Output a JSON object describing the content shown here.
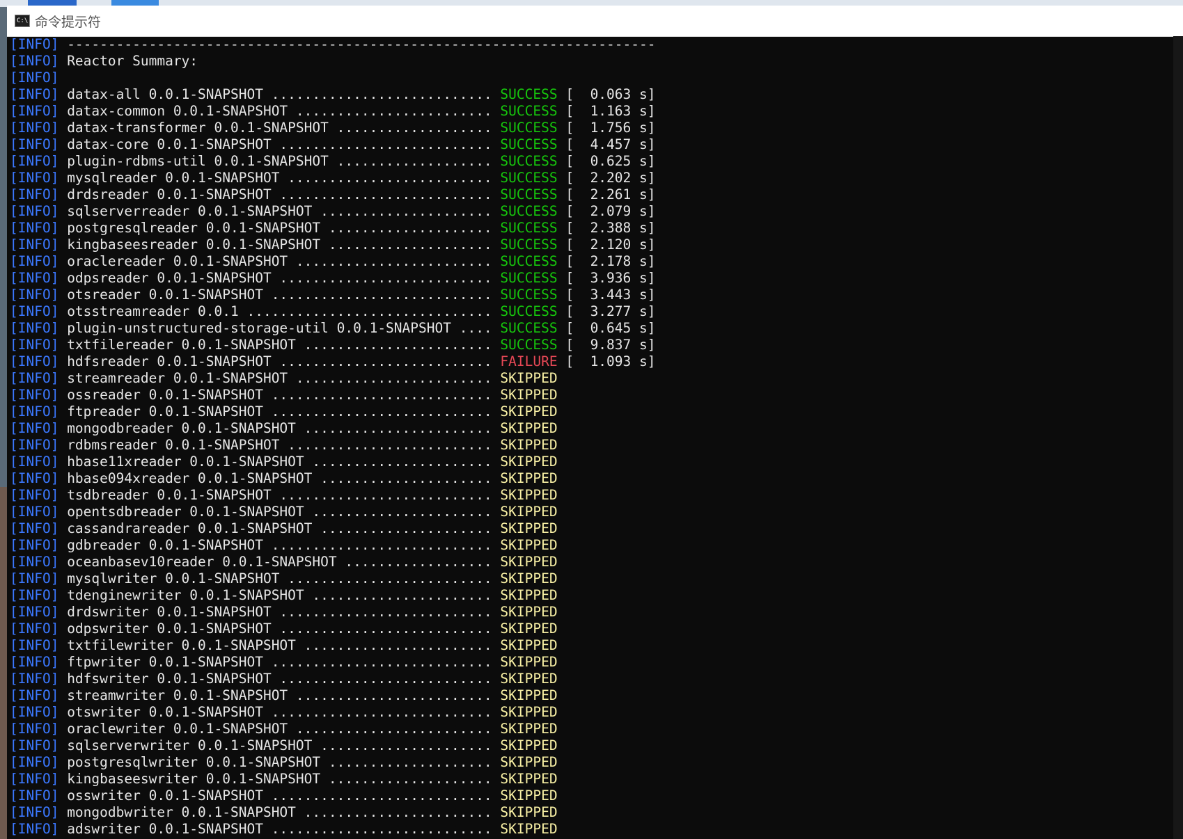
{
  "window": {
    "title": "命令提示符",
    "icon": "cmd-console-icon"
  },
  "console": {
    "colors": {
      "info_tag": "#3b78ff",
      "text": "#e6e6e6",
      "SUCCESS": "#16c60c",
      "FAILURE": "#e74856",
      "SKIPPED": "#f9f1a5",
      "background": "#0c0c0c"
    },
    "lines": [
      {
        "tag": "[INFO]",
        "text": " ------------------------------------------------------------------------"
      },
      {
        "tag": "[INFO]",
        "text": " Reactor Summary:"
      },
      {
        "tag": "[INFO]",
        "text": ""
      },
      {
        "tag": "[INFO]",
        "text": " datax-all 0.0.1-SNAPSHOT ........................... ",
        "status": "SUCCESS",
        "time": " [  0.063 s]"
      },
      {
        "tag": "[INFO]",
        "text": " datax-common 0.0.1-SNAPSHOT ........................ ",
        "status": "SUCCESS",
        "time": " [  1.163 s]"
      },
      {
        "tag": "[INFO]",
        "text": " datax-transformer 0.0.1-SNAPSHOT ................... ",
        "status": "SUCCESS",
        "time": " [  1.756 s]"
      },
      {
        "tag": "[INFO]",
        "text": " datax-core 0.0.1-SNAPSHOT .......................... ",
        "status": "SUCCESS",
        "time": " [  4.457 s]"
      },
      {
        "tag": "[INFO]",
        "text": " plugin-rdbms-util 0.0.1-SNAPSHOT ................... ",
        "status": "SUCCESS",
        "time": " [  0.625 s]"
      },
      {
        "tag": "[INFO]",
        "text": " mysqlreader 0.0.1-SNAPSHOT ......................... ",
        "status": "SUCCESS",
        "time": " [  2.202 s]"
      },
      {
        "tag": "[INFO]",
        "text": " drdsreader 0.0.1-SNAPSHOT .......................... ",
        "status": "SUCCESS",
        "time": " [  2.261 s]"
      },
      {
        "tag": "[INFO]",
        "text": " sqlserverreader 0.0.1-SNAPSHOT ..................... ",
        "status": "SUCCESS",
        "time": " [  2.079 s]"
      },
      {
        "tag": "[INFO]",
        "text": " postgresqlreader 0.0.1-SNAPSHOT .................... ",
        "status": "SUCCESS",
        "time": " [  2.388 s]"
      },
      {
        "tag": "[INFO]",
        "text": " kingbaseesreader 0.0.1-SNAPSHOT .................... ",
        "status": "SUCCESS",
        "time": " [  2.120 s]"
      },
      {
        "tag": "[INFO]",
        "text": " oraclereader 0.0.1-SNAPSHOT ........................ ",
        "status": "SUCCESS",
        "time": " [  2.178 s]"
      },
      {
        "tag": "[INFO]",
        "text": " odpsreader 0.0.1-SNAPSHOT .......................... ",
        "status": "SUCCESS",
        "time": " [  3.936 s]"
      },
      {
        "tag": "[INFO]",
        "text": " otsreader 0.0.1-SNAPSHOT ........................... ",
        "status": "SUCCESS",
        "time": " [  3.443 s]"
      },
      {
        "tag": "[INFO]",
        "text": " otsstreamreader 0.0.1 .............................. ",
        "status": "SUCCESS",
        "time": " [  3.277 s]"
      },
      {
        "tag": "[INFO]",
        "text": " plugin-unstructured-storage-util 0.0.1-SNAPSHOT .... ",
        "status": "SUCCESS",
        "time": " [  0.645 s]"
      },
      {
        "tag": "[INFO]",
        "text": " txtfilereader 0.0.1-SNAPSHOT ....................... ",
        "status": "SUCCESS",
        "time": " [  9.837 s]"
      },
      {
        "tag": "[INFO]",
        "text": " hdfsreader 0.0.1-SNAPSHOT .......................... ",
        "status": "FAILURE",
        "time": " [  1.093 s]"
      },
      {
        "tag": "[INFO]",
        "text": " streamreader 0.0.1-SNAPSHOT ........................ ",
        "status": "SKIPPED"
      },
      {
        "tag": "[INFO]",
        "text": " ossreader 0.0.1-SNAPSHOT ........................... ",
        "status": "SKIPPED"
      },
      {
        "tag": "[INFO]",
        "text": " ftpreader 0.0.1-SNAPSHOT ........................... ",
        "status": "SKIPPED"
      },
      {
        "tag": "[INFO]",
        "text": " mongodbreader 0.0.1-SNAPSHOT ....................... ",
        "status": "SKIPPED"
      },
      {
        "tag": "[INFO]",
        "text": " rdbmsreader 0.0.1-SNAPSHOT ......................... ",
        "status": "SKIPPED"
      },
      {
        "tag": "[INFO]",
        "text": " hbase11xreader 0.0.1-SNAPSHOT ...................... ",
        "status": "SKIPPED"
      },
      {
        "tag": "[INFO]",
        "text": " hbase094xreader 0.0.1-SNAPSHOT ..................... ",
        "status": "SKIPPED"
      },
      {
        "tag": "[INFO]",
        "text": " tsdbreader 0.0.1-SNAPSHOT .......................... ",
        "status": "SKIPPED"
      },
      {
        "tag": "[INFO]",
        "text": " opentsdbreader 0.0.1-SNAPSHOT ...................... ",
        "status": "SKIPPED"
      },
      {
        "tag": "[INFO]",
        "text": " cassandrareader 0.0.1-SNAPSHOT ..................... ",
        "status": "SKIPPED"
      },
      {
        "tag": "[INFO]",
        "text": " gdbreader 0.0.1-SNAPSHOT ........................... ",
        "status": "SKIPPED"
      },
      {
        "tag": "[INFO]",
        "text": " oceanbasev10reader 0.0.1-SNAPSHOT .................. ",
        "status": "SKIPPED"
      },
      {
        "tag": "[INFO]",
        "text": " mysqlwriter 0.0.1-SNAPSHOT ......................... ",
        "status": "SKIPPED"
      },
      {
        "tag": "[INFO]",
        "text": " tdenginewriter 0.0.1-SNAPSHOT ...................... ",
        "status": "SKIPPED"
      },
      {
        "tag": "[INFO]",
        "text": " drdswriter 0.0.1-SNAPSHOT .......................... ",
        "status": "SKIPPED"
      },
      {
        "tag": "[INFO]",
        "text": " odpswriter 0.0.1-SNAPSHOT .......................... ",
        "status": "SKIPPED"
      },
      {
        "tag": "[INFO]",
        "text": " txtfilewriter 0.0.1-SNAPSHOT ....................... ",
        "status": "SKIPPED"
      },
      {
        "tag": "[INFO]",
        "text": " ftpwriter 0.0.1-SNAPSHOT ........................... ",
        "status": "SKIPPED"
      },
      {
        "tag": "[INFO]",
        "text": " hdfswriter 0.0.1-SNAPSHOT .......................... ",
        "status": "SKIPPED"
      },
      {
        "tag": "[INFO]",
        "text": " streamwriter 0.0.1-SNAPSHOT ........................ ",
        "status": "SKIPPED"
      },
      {
        "tag": "[INFO]",
        "text": " otswriter 0.0.1-SNAPSHOT ........................... ",
        "status": "SKIPPED"
      },
      {
        "tag": "[INFO]",
        "text": " oraclewriter 0.0.1-SNAPSHOT ........................ ",
        "status": "SKIPPED"
      },
      {
        "tag": "[INFO]",
        "text": " sqlserverwriter 0.0.1-SNAPSHOT ..................... ",
        "status": "SKIPPED"
      },
      {
        "tag": "[INFO]",
        "text": " postgresqlwriter 0.0.1-SNAPSHOT .................... ",
        "status": "SKIPPED"
      },
      {
        "tag": "[INFO]",
        "text": " kingbaseeswriter 0.0.1-SNAPSHOT .................... ",
        "status": "SKIPPED"
      },
      {
        "tag": "[INFO]",
        "text": " osswriter 0.0.1-SNAPSHOT ........................... ",
        "status": "SKIPPED"
      },
      {
        "tag": "[INFO]",
        "text": " mongodbwriter 0.0.1-SNAPSHOT ....................... ",
        "status": "SKIPPED"
      },
      {
        "tag": "[INFO]",
        "text": " adswriter 0.0.1-SNAPSHOT ........................... ",
        "status": "SKIPPED"
      }
    ]
  }
}
